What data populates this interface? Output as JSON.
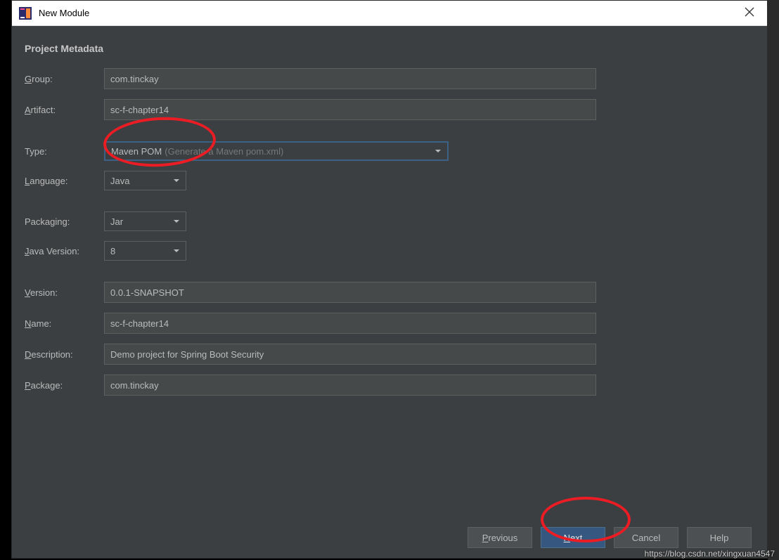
{
  "titlebar": {
    "title": "New Module"
  },
  "header": "Project Metadata",
  "labels": {
    "group_pre": "G",
    "group_post": "roup:",
    "artifact_pre": "A",
    "artifact_post": "rtifact:",
    "type": "Type:",
    "language_pre": "L",
    "language_post": "anguage:",
    "packaging": "Packaging:",
    "javaVersion_pre": "J",
    "javaVersion_post": "ava Version:",
    "version_pre": "V",
    "version_post": "ersion:",
    "name_pre": "N",
    "name_post": "ame:",
    "description_pre": "D",
    "description_post": "escription:",
    "package_pre": "P",
    "package_post": "ackage:"
  },
  "fields": {
    "group": "com.tinckay",
    "artifact": "sc-f-chapter14",
    "type_label": "Maven POM",
    "type_hint": "(Generate a Maven pom.xml)",
    "language": "Java",
    "packaging": "Jar",
    "javaVersion": "8",
    "version": "0.0.1-SNAPSHOT",
    "name": "sc-f-chapter14",
    "description": "Demo project for Spring Boot Security",
    "pkg": "com.tinckay"
  },
  "buttons": {
    "previous_pre": "P",
    "previous_post": "revious",
    "next_pre": "N",
    "next_post": "ext",
    "cancel": "Cancel",
    "help": "Help"
  },
  "watermark": "https://blog.csdn.net/xingxuan4547"
}
